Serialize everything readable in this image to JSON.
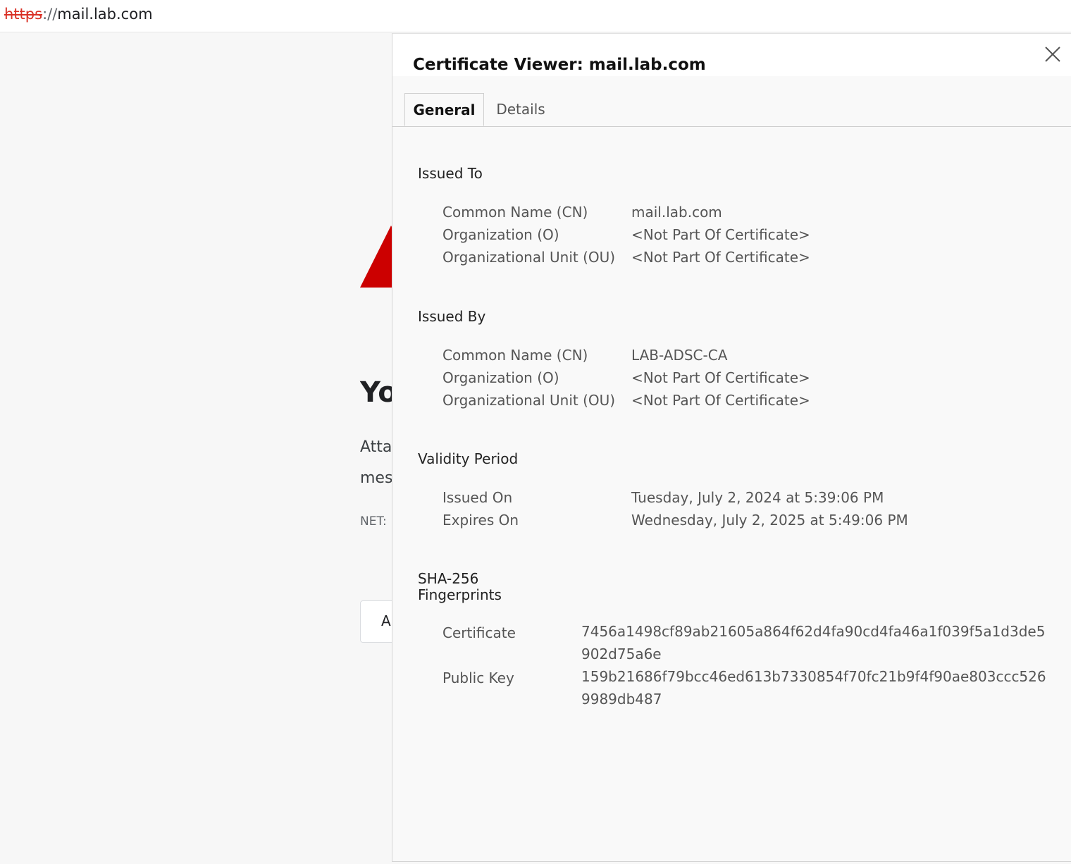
{
  "address_bar": {
    "scheme": "https",
    "separator": "://",
    "host": "mail.lab.com"
  },
  "background_page": {
    "heading": "Yo",
    "line1": "Atta",
    "line2": "mes",
    "error_code": "NET:",
    "button_label": "A",
    "warning_color": "#cc0000"
  },
  "dialog": {
    "title": "Certificate Viewer: mail.lab.com",
    "close_icon": "close-icon",
    "tabs": [
      {
        "label": "General",
        "active": true
      },
      {
        "label": "Details",
        "active": false
      }
    ],
    "issued_to": {
      "title": "Issued To",
      "rows": [
        {
          "label": "Common Name (CN)",
          "value": "mail.lab.com"
        },
        {
          "label": "Organization (O)",
          "value": "<Not Part Of Certificate>"
        },
        {
          "label": "Organizational Unit (OU)",
          "value": "<Not Part Of Certificate>"
        }
      ]
    },
    "issued_by": {
      "title": "Issued By",
      "rows": [
        {
          "label": "Common Name (CN)",
          "value": "LAB-ADSC-CA"
        },
        {
          "label": "Organization (O)",
          "value": "<Not Part Of Certificate>"
        },
        {
          "label": "Organizational Unit (OU)",
          "value": "<Not Part Of Certificate>"
        }
      ]
    },
    "validity": {
      "title": "Validity Period",
      "rows": [
        {
          "label": "Issued On",
          "value": "Tuesday, July 2, 2024 at 5:39:06 PM"
        },
        {
          "label": "Expires On",
          "value": "Wednesday, July 2, 2025 at 5:49:06 PM"
        }
      ]
    },
    "fingerprints": {
      "title_line1": "SHA-256",
      "title_line2": "Fingerprints",
      "rows": [
        {
          "label": "Certificate",
          "value": "7456a1498cf89ab21605a864f62d4fa90cd4fa46a1f039f5a1d3de5902d75a6e"
        },
        {
          "label": "Public Key",
          "value": "159b21686f79bcc46ed613b7330854f70fc21b9f4f90ae803ccc5269989db487"
        }
      ]
    }
  }
}
